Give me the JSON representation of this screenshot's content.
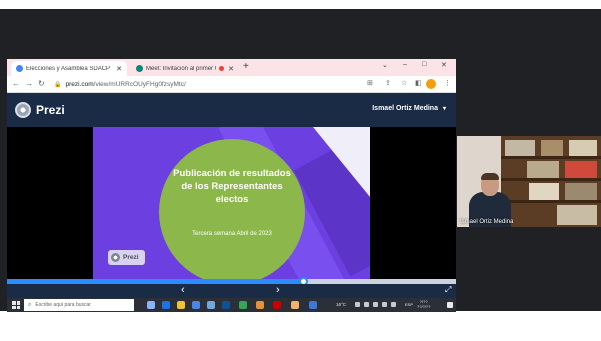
{
  "browser": {
    "tabs": [
      {
        "title": "Elecciones y Asamblea SDACP I:",
        "favicon_color": "#4285f4",
        "active": true
      },
      {
        "title": "Meet: Invitación al primer C",
        "favicon_color": "#00897b",
        "active": false,
        "recording": true
      }
    ],
    "new_tab_label": "+",
    "url": {
      "host": "prezi.com",
      "path": "/view/mURRcOUyFHg0fzsyMtc/"
    },
    "window_controls": {
      "minimize": "–",
      "maximize": "□",
      "close": "✕"
    }
  },
  "prezi": {
    "logo_text": "Prezi",
    "user_name": "Ismael Ortiz Medina",
    "slide": {
      "title": "Publicación de resultados de los Representantes electos",
      "subtitle": "Tercera semana Abril de 2023",
      "badge_text": "Prezi"
    },
    "progress": 0.66,
    "controls": {
      "prev": "‹",
      "next": "›",
      "fullscreen": "⤢"
    }
  },
  "taskbar": {
    "search_placeholder": "Escribe aquí para buscar",
    "temperature": "16°C",
    "language": "ESP",
    "time": "?/??",
    "date": "??/?/??"
  },
  "participant": {
    "name": "Ismael Ortiz Medina"
  },
  "colors": {
    "prezi_navy": "#1a2b45",
    "slide_purple": "#6b3fe0",
    "slide_green": "#8cb74b",
    "progress_blue": "#2a8cff"
  }
}
